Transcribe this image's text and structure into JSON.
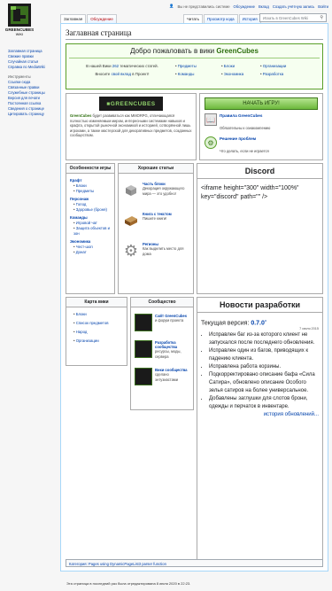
{
  "logo": {
    "line1": "GREENCUBES",
    "line2": "WIKI"
  },
  "personal": {
    "not_logged_in": "Вы не представились системе",
    "talk": "Обсуждение",
    "contributions": "Вклад",
    "create_account": "Создать учётную запись",
    "login": "Войти"
  },
  "tabs_left": [
    {
      "label": "Заглавная",
      "selected": true
    },
    {
      "label": "Обсуждение",
      "selected": false
    }
  ],
  "tabs_right": [
    {
      "label": "Читать",
      "selected": true
    },
    {
      "label": "Просмотр кода",
      "selected": false
    },
    {
      "label": "История",
      "selected": false
    }
  ],
  "search": {
    "placeholder": "Искать в GreenCubes Wiki"
  },
  "sidebar": {
    "main": [
      "Заглавная страница",
      "Свежие правки",
      "Случайная статья",
      "Справка по MediaWiki"
    ],
    "tools_header": "Инструменты",
    "tools": [
      "Ссылки сюда",
      "Связанные правки",
      "Служебные страницы",
      "Версия для печати",
      "Постоянная ссылка",
      "Сведения о странице",
      "Цитировать страницу"
    ]
  },
  "page_title": "Заглавная страница",
  "welcome": {
    "prefix": "Добро пожаловать в вики ",
    "brand": "GreenCubes",
    "intro_1": "В нашей Вики ",
    "count": "262",
    "intro_2": " тематических статей.",
    "intro_3": "Вносите ",
    "intro_link": "свой вклад",
    "intro_4": " в Проект!",
    "col1": [
      "Предметы",
      "Команды"
    ],
    "col2": [
      "Блоки",
      "Экономика"
    ],
    "col3": [
      "Организации",
      "Разработка"
    ]
  },
  "about": {
    "brand": "GreenCubes",
    "text": " будет развиваться как MMORPG, отличающаяся полностью изменяемым миром, интересными системами навыков и крафта, открытой рыночной экономикой и историей, сотворённой лишь игроками, а также мастерской для декоративных предметов, созданных сообществом."
  },
  "play": {
    "label": "НАЧАТЬ ИГРУ!",
    "rules_title": "Правила GreenCubes",
    "rules_sub": "Обязательны к ознакомлению",
    "solutions_title": "Решение проблем",
    "solutions_sub": "Что делать, если не играется"
  },
  "features_col": {
    "title": "Особенности игры",
    "sections": [
      {
        "title": "Крафт",
        "items": [
          "Блоки",
          "Предметы"
        ]
      },
      {
        "title": "Персонаж",
        "items": [
          "Голод",
          "Здоровье (броня)"
        ]
      },
      {
        "title": "Команды",
        "items": [
          "Игровой чат",
          "Защита объектов и зон"
        ]
      },
      {
        "title": "Экономика",
        "items": [
          "Чест-шоп",
          "Донат"
        ]
      }
    ]
  },
  "good_articles": {
    "title": "Хорошие статьи",
    "items": [
      {
        "title": "Часть блоки",
        "desc": "Декорация окружающего мира — это удобно!"
      },
      {
        "title": "Книга с текстом",
        "desc": "Пишите книги!"
      },
      {
        "title": "Регионы",
        "desc": "Как выделить место для дома"
      }
    ]
  },
  "discord": {
    "title": "Discord",
    "code": "<iframe height=\"300\" width=\"100%\" key=\"discord\" path=\"\" />"
  },
  "wiki_map": {
    "title": "Карта вики",
    "items": [
      "Блоки",
      "Список предметов",
      "Народ",
      "Организации"
    ]
  },
  "community": {
    "title": "Сообщество",
    "items": [
      {
        "title": "Сайт GreenCubes",
        "desc": "и форум проекта"
      },
      {
        "title": "Разработка сообщества",
        "desc": "ресурсы, моды, сервера"
      },
      {
        "title": "Вики сообщества",
        "desc": "сделано энтузиастами"
      }
    ]
  },
  "dev_news": {
    "title": "Новости разработки",
    "version_label": "Текущая версия: ",
    "version": "0.7.0",
    "version_suffix": "o",
    "date": "7 июля 2015",
    "items": [
      "Исправлен баг из-за которого клиент не запускался после последнего обновления.",
      "Исправлен один из багов, приводящих к падению клиента.",
      "Исправлена работа корзины.",
      "Подкорректировано описание бафа «Сила Сатира», обновлено описание Особого зелья сатиров на более универсальное.",
      "Добавлены заглушки для слотов брони, одежды и перчаток в инвентаре."
    ],
    "history": "история обновлений..."
  },
  "categories": {
    "label": "Категория: ",
    "link": "Pages using DynamicPageList3 parser function"
  },
  "footer": {
    "text": "Эта страница в последний раз была отредактирована 8 июля 2020 в 22:23."
  },
  "colors": {
    "green": "#2d6e0e",
    "link": "#0645ad",
    "button": "#8fd06a"
  }
}
